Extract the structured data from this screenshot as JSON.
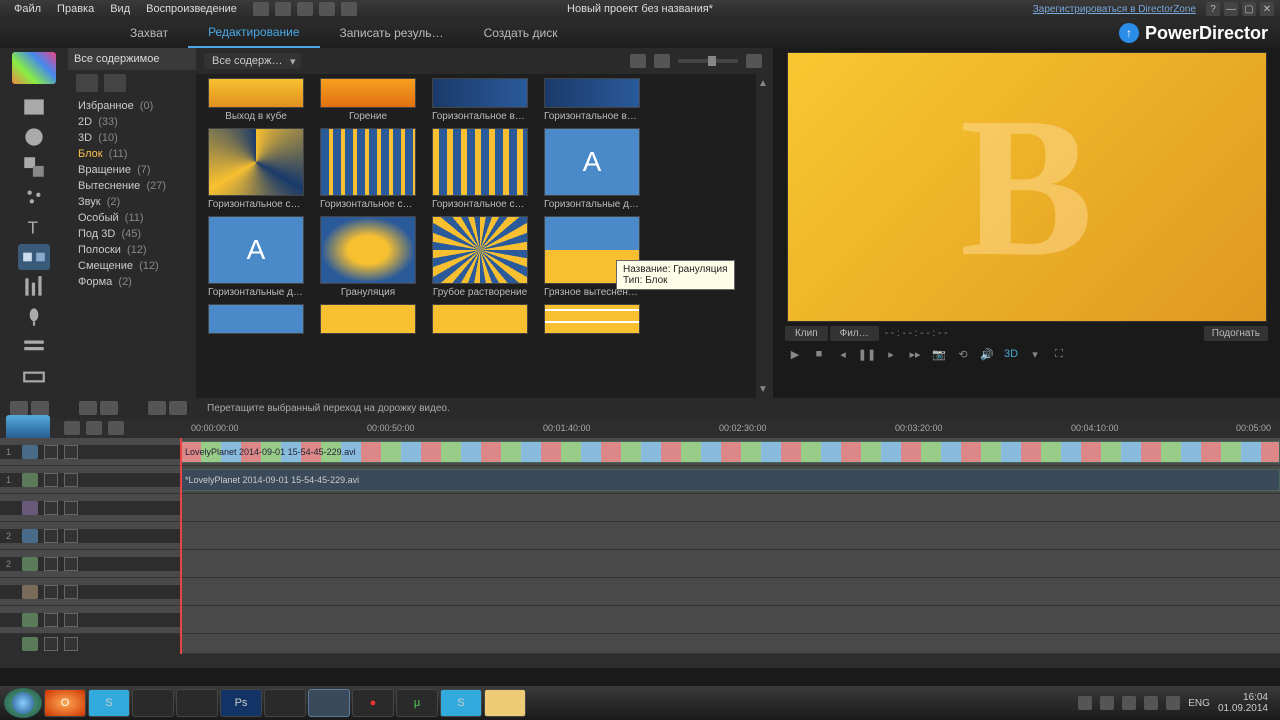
{
  "topbar": {
    "menus": [
      "Файл",
      "Правка",
      "Вид",
      "Воспроизведение"
    ],
    "project_title": "Новый проект без названия*",
    "director_link": "Зарегистрироваться в DirectorZone"
  },
  "tabs": {
    "items": [
      "Захват",
      "Редактирование",
      "Записать резуль…",
      "Создать диск"
    ],
    "active_index": 1
  },
  "brand": "PowerDirector",
  "category": {
    "header": "Все содержимое",
    "items": [
      {
        "label": "Избранное",
        "count": "(0)"
      },
      {
        "label": "2D",
        "count": "(33)"
      },
      {
        "label": "3D",
        "count": "(10)"
      },
      {
        "label": "Блок",
        "count": "(11)"
      },
      {
        "label": "Вращение",
        "count": "(7)"
      },
      {
        "label": "Вытеснение",
        "count": "(27)"
      },
      {
        "label": "Звук",
        "count": "(2)"
      },
      {
        "label": "Особый",
        "count": "(11)"
      },
      {
        "label": "Под 3D",
        "count": "(45)"
      },
      {
        "label": "Полоски",
        "count": "(12)"
      },
      {
        "label": "Смещение",
        "count": "(12)"
      },
      {
        "label": "Форма",
        "count": "(2)"
      }
    ],
    "selected_index": 3
  },
  "browser": {
    "filter": "Все содерж…",
    "thumbs_row1": [
      "Выход в кубе",
      "Горение",
      "Горизонтальное вр…",
      "Горизонтальное вр…"
    ],
    "thumbs_row2": [
      "Горизонтальное ск…",
      "Горизонтальное см…",
      "Горизонтальное см…",
      "Горизонтальные до…"
    ],
    "thumbs_row3": [
      "Горизонтальные до…",
      "Грануляция",
      "Грубое растворение",
      "Грязное вытеснени…"
    ],
    "tooltip_line1": "Название: Грануляция",
    "tooltip_line2": "Тип: Блок"
  },
  "preview": {
    "tabs": [
      "Клип",
      "Фил…"
    ],
    "timecode": "- - : - - : - - : - -",
    "fit_button": "Подогнать",
    "d3_label": "3D"
  },
  "hint": "Перетащите выбранный переход на дорожку видео.",
  "timeline": {
    "marks": [
      "00:00:00:00",
      "00:00:50:00",
      "00:01:40:00",
      "00:02:30:00",
      "00:03:20:00",
      "00:04:10:00",
      "00:05:00"
    ],
    "video_clip": "LovelyPlanet 2014-09-01 15-54-45-229.avi",
    "audio_clip": "*LovelyPlanet 2014-09-01 15-54-45-229.avi"
  },
  "taskbar": {
    "lang": "ENG",
    "time": "16:04",
    "date": "01.09.2014"
  }
}
